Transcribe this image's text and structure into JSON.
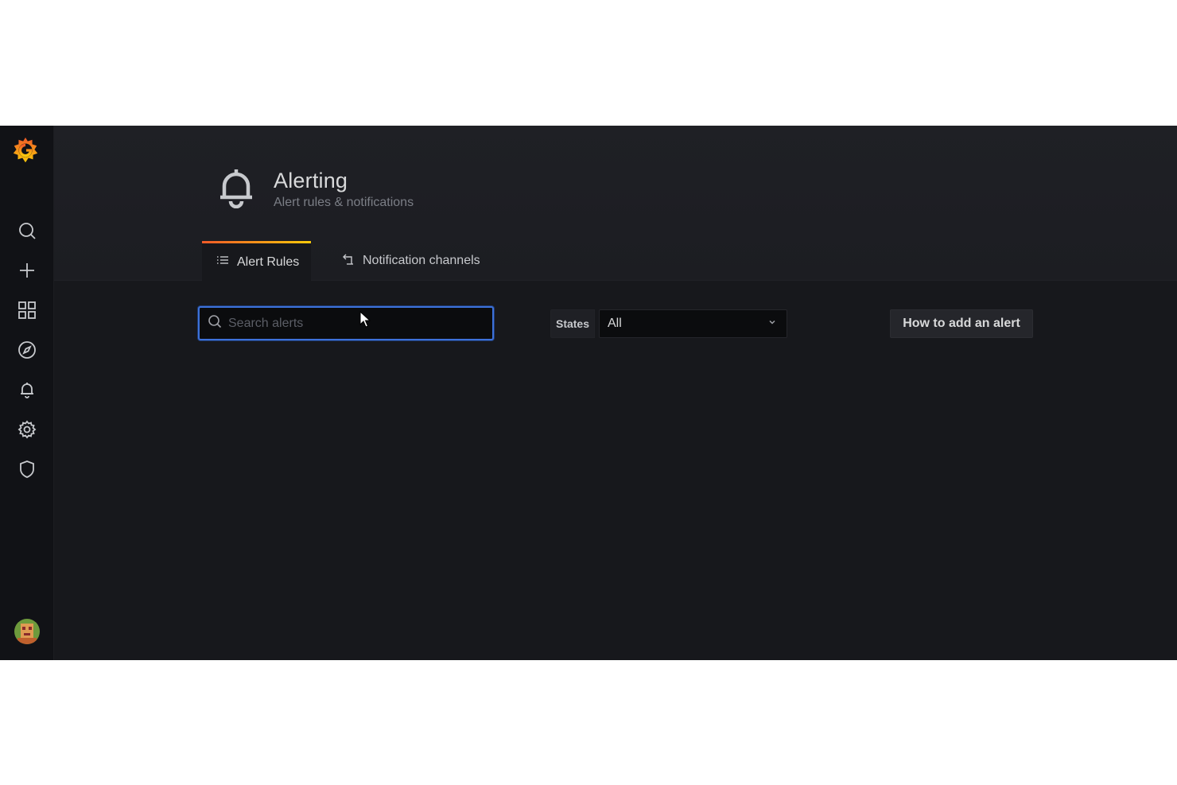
{
  "sidebar": {
    "logo": "grafana-logo",
    "items": [
      {
        "icon": "search-icon"
      },
      {
        "icon": "plus-icon"
      },
      {
        "icon": "dashboards-icon"
      },
      {
        "icon": "explore-compass-icon"
      },
      {
        "icon": "bell-icon"
      },
      {
        "icon": "gear-icon"
      },
      {
        "icon": "shield-icon"
      }
    ],
    "avatar": "user-avatar"
  },
  "header": {
    "icon": "bell-icon",
    "title": "Alerting",
    "subtitle": "Alert rules & notifications"
  },
  "tabs": [
    {
      "label": "Alert Rules",
      "icon": "list-icon",
      "active": true
    },
    {
      "label": "Notification channels",
      "icon": "channel-arrow-icon",
      "active": false
    }
  ],
  "toolbar": {
    "search": {
      "placeholder": "Search alerts",
      "value": ""
    },
    "states_label": "States",
    "states_value": "All",
    "howto_label": "How to add an alert"
  },
  "colors": {
    "background": "#17181c",
    "sidebar": "#111216",
    "accent_blue": "#3d71d9",
    "tab_gradient_start": "#f05a28",
    "tab_gradient_end": "#fbca0a"
  }
}
